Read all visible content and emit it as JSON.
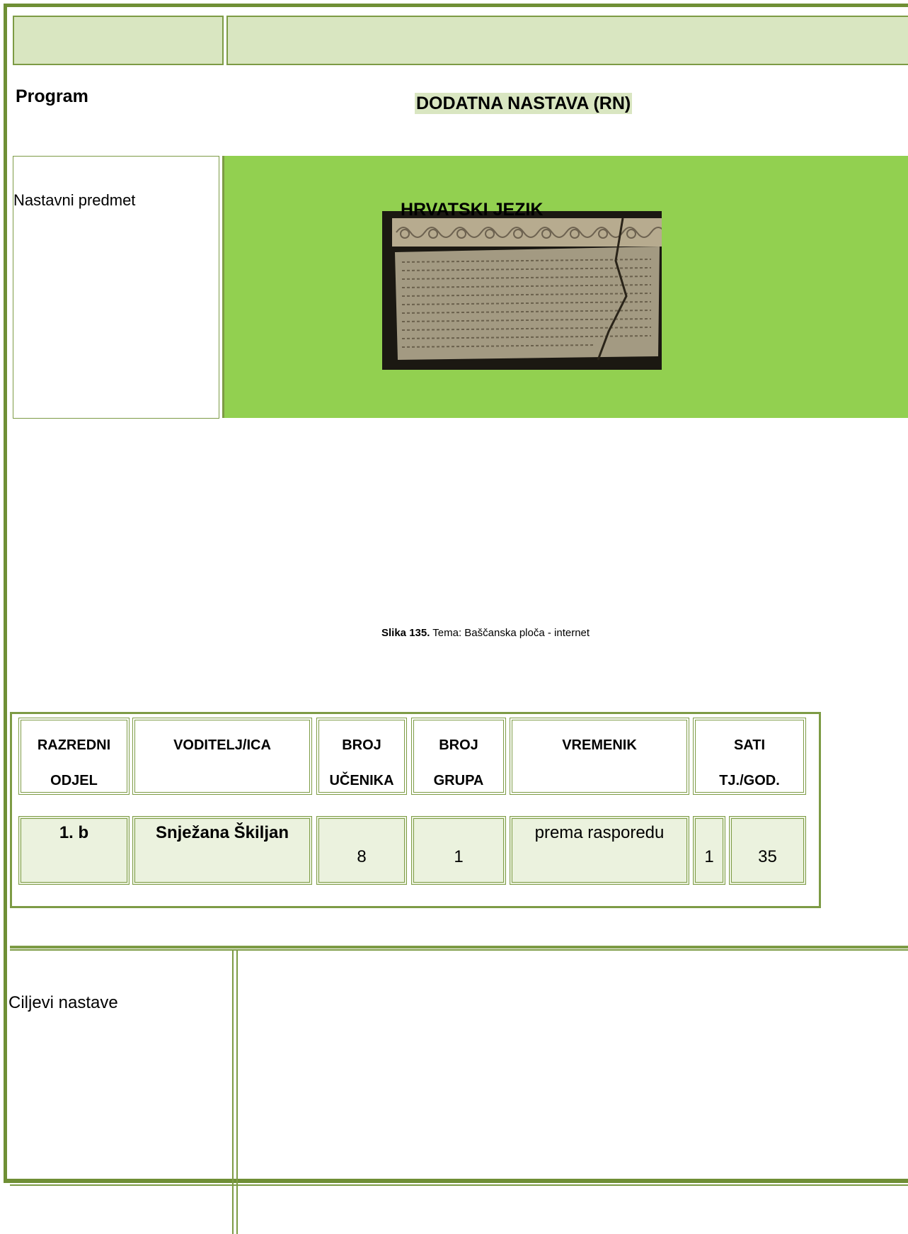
{
  "program": {
    "label": "Program",
    "title": "DODATNA NASTAVA (RN)"
  },
  "subject": {
    "label": "Nastavni predmet",
    "name": "HRVATSKI JEZIK"
  },
  "figure": {
    "caption_bold": "Slika 135.",
    "caption_text": " Tema: Baščanska ploča - internet"
  },
  "table": {
    "headers": [
      {
        "line1": "RAZREDNI",
        "line2": "ODJEL"
      },
      {
        "line1": "VODITELJ/ICA",
        "line2": ""
      },
      {
        "line1": "BROJ",
        "line2": "UČENIKA"
      },
      {
        "line1": "BROJ",
        "line2": "GRUPA"
      },
      {
        "line1": "VREMENIK",
        "line2": ""
      },
      {
        "line1": "SATI",
        "line2": "TJ./GOD."
      }
    ],
    "row": {
      "odjel": "1. b",
      "voditelj": "Snježana Škiljan",
      "broj_ucenika": "8",
      "broj_grupa": "1",
      "vremenik": "prema rasporedu",
      "sati_tj": "1",
      "sati_god": "35"
    }
  },
  "goals": {
    "label": "Ciljevi nastave"
  },
  "colors": {
    "border": "#6f8f35",
    "light_fill": "#d9e6c1",
    "green_fill": "#92d050",
    "row_fill": "#ebf2de"
  }
}
